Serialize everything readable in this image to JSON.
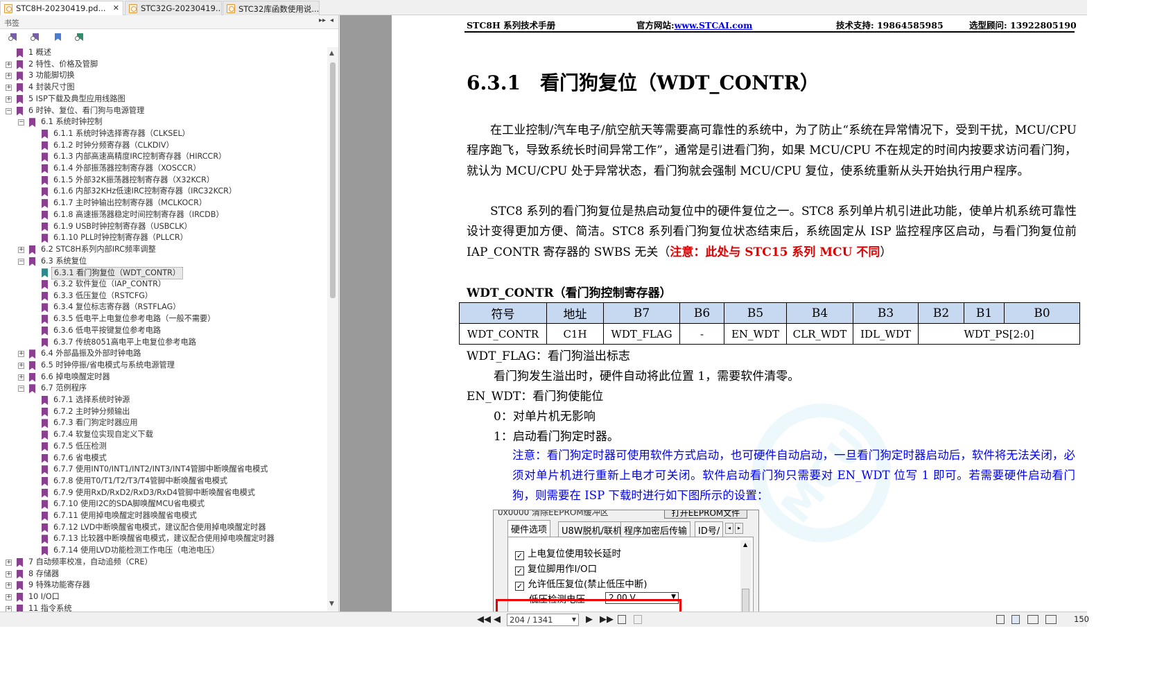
{
  "tabs": [
    {
      "label": "STC8H-20230419.pd...",
      "closable": true,
      "active": true
    },
    {
      "label": "STC32G-20230419....",
      "closable": false,
      "active": false
    },
    {
      "label": "STC32库函数使用说...",
      "closable": false,
      "active": false
    }
  ],
  "sidebar": {
    "title": "书签",
    "collapse_glyph": "▸▸",
    "pin_glyph": "◂",
    "items": [
      {
        "label": "1 概述",
        "level": 0,
        "expand": ""
      },
      {
        "label": "2 特性、价格及管脚",
        "level": 0,
        "expand": "+"
      },
      {
        "label": "3 功能脚切换",
        "level": 0,
        "expand": "+"
      },
      {
        "label": "4 封装尺寸图",
        "level": 0,
        "expand": "+"
      },
      {
        "label": "5 ISP下载及典型应用线路图",
        "level": 0,
        "expand": "+"
      },
      {
        "label": "6 时钟、复位、看门狗与电源管理",
        "level": 0,
        "expand": "−"
      },
      {
        "label": "6.1 系统时钟控制",
        "level": 1,
        "expand": "−"
      },
      {
        "label": "6.1.1 系统时钟选择寄存器（CLKSEL）",
        "level": 2,
        "expand": ""
      },
      {
        "label": "6.1.2 时钟分频寄存器（CLKDIV）",
        "level": 2,
        "expand": ""
      },
      {
        "label": "6.1.3 内部高速高精度IRC控制寄存器（HIRCCR）",
        "level": 2,
        "expand": ""
      },
      {
        "label": "6.1.4 外部振荡器控制寄存器（XOSCCR）",
        "level": 2,
        "expand": ""
      },
      {
        "label": "6.1.5 外部32K振荡器控制寄存器（X32KCR）",
        "level": 2,
        "expand": ""
      },
      {
        "label": "6.1.6 内部32KHz低速IRC控制寄存器（IRC32KCR）",
        "level": 2,
        "expand": ""
      },
      {
        "label": "6.1.7 主时钟输出控制寄存器（MCLKOCR）",
        "level": 2,
        "expand": ""
      },
      {
        "label": "6.1.8 高速振荡器稳定时间控制寄存器（IRCDB）",
        "level": 2,
        "expand": ""
      },
      {
        "label": "6.1.9 USB时钟控制寄存器（USBCLK）",
        "level": 2,
        "expand": ""
      },
      {
        "label": "6.1.10 PLL时钟控制寄存器（PLLCR）",
        "level": 2,
        "expand": ""
      },
      {
        "label": "6.2 STC8H系列内部IRC频率调整",
        "level": 1,
        "expand": "+"
      },
      {
        "label": "6.3 系统复位",
        "level": 1,
        "expand": "−"
      },
      {
        "label": "6.3.1 看门狗复位（WDT_CONTR）",
        "level": 2,
        "expand": "",
        "selected": true
      },
      {
        "label": "6.3.2 软件复位（IAP_CONTR）",
        "level": 2,
        "expand": ""
      },
      {
        "label": "6.3.3 低压复位（RSTCFG）",
        "level": 2,
        "expand": ""
      },
      {
        "label": "6.3.4 复位标志寄存器（RSTFLAG）",
        "level": 2,
        "expand": ""
      },
      {
        "label": "6.3.5 低电平上电复位参考电路（一般不需要）",
        "level": 2,
        "expand": ""
      },
      {
        "label": "6.3.6 低电平按键复位参考电路",
        "level": 2,
        "expand": ""
      },
      {
        "label": "6.3.7 传统8051高电平上电复位参考电路",
        "level": 2,
        "expand": ""
      },
      {
        "label": "6.4 外部晶振及外部时钟电路",
        "level": 1,
        "expand": "+"
      },
      {
        "label": "6.5 时钟停振/省电模式与系统电源管理",
        "level": 1,
        "expand": "+"
      },
      {
        "label": "6.6 掉电唤醒定时器",
        "level": 1,
        "expand": "+"
      },
      {
        "label": "6.7 范例程序",
        "level": 1,
        "expand": "−"
      },
      {
        "label": "6.7.1 选择系统时钟源",
        "level": 2,
        "expand": ""
      },
      {
        "label": "6.7.2 主时钟分频输出",
        "level": 2,
        "expand": ""
      },
      {
        "label": "6.7.3 看门狗定时器应用",
        "level": 2,
        "expand": ""
      },
      {
        "label": "6.7.4 软复位实现自定义下载",
        "level": 2,
        "expand": ""
      },
      {
        "label": "6.7.5 低压检测",
        "level": 2,
        "expand": ""
      },
      {
        "label": "6.7.6 省电模式",
        "level": 2,
        "expand": ""
      },
      {
        "label": "6.7.7 使用INT0/INT1/INT2/INT3/INT4管脚中断唤醒省电模式",
        "level": 2,
        "expand": ""
      },
      {
        "label": "6.7.8 使用T0/T1/T2/T3/T4管脚中断唤醒省电模式",
        "level": 2,
        "expand": ""
      },
      {
        "label": "6.7.9 使用RxD/RxD2/RxD3/RxD4管脚中断唤醒省电模式",
        "level": 2,
        "expand": ""
      },
      {
        "label": "6.7.10 使用I2C的SDA脚唤醒MCU省电模式",
        "level": 2,
        "expand": ""
      },
      {
        "label": "6.7.11 使用掉电唤醒定时器唤醒省电模式",
        "level": 2,
        "expand": ""
      },
      {
        "label": "6.7.12 LVD中断唤醒省电模式，建议配合使用掉电唤醒定时器",
        "level": 2,
        "expand": ""
      },
      {
        "label": "6.7.13 比较器中断唤醒省电模式，建议配合使用掉电唤醒定时器",
        "level": 2,
        "expand": ""
      },
      {
        "label": "6.7.14 使用LVD功能检测工作电压（电池电压）",
        "level": 2,
        "expand": ""
      },
      {
        "label": "7 自动频率校准，自动追频（CRE）",
        "level": 0,
        "expand": "+"
      },
      {
        "label": "8 存储器",
        "level": 0,
        "expand": "+"
      },
      {
        "label": "9 特殊功能寄存器",
        "level": 0,
        "expand": "+"
      },
      {
        "label": "10 I/O口",
        "level": 0,
        "expand": "+"
      },
      {
        "label": "11 指令系统",
        "level": 0,
        "expand": "+"
      }
    ]
  },
  "document": {
    "header": {
      "manual": "STC8H 系列技术手册",
      "site_label": "官方网站:",
      "site_url": "www.STCAI.com",
      "support": "技术支持: 19864585985",
      "sales": "选型顾问: 13922805190"
    },
    "heading": "6.3.1　看门狗复位（WDT_CONTR）",
    "para1": "在工业控制/汽车电子/航空航天等需要高可靠性的系统中，为了防止“系统在异常情况下，受到干扰，MCU/CPU 程序跑飞，导致系统长时间异常工作”，通常是引进看门狗，如果 MCU/CPU 不在规定的时间内按要求访问看门狗，就认为 MCU/CPU 处于异常状态，看门狗就会强制 MCU/CPU 复位，使系统重新从头开始执行用户程序。",
    "para2_pre": "STC8 系列的看门狗复位是热启动复位中的硬件复位之一。STC8 系列单片机引进此功能，使单片机系统可靠性设计变得更加方便、简洁。STC8 系列看门狗复位状态结束后，系统固定从 ISP 监控程序区启动，与看门狗复位前 IAP_CONTR 寄存器的 SWBS 无关（",
    "para2_note": "注意：此处与 STC15 系列 MCU 不同",
    "para2_post": "）",
    "reg_title": "WDT_CONTR（看门狗控制寄存器）",
    "reg_head": [
      "符号",
      "地址",
      "B7",
      "B6",
      "B5",
      "B4",
      "B3",
      "B2",
      "B1",
      "B0"
    ],
    "reg_row": [
      "WDT_CONTR",
      "C1H",
      "WDT_FLAG",
      "-",
      "EN_WDT",
      "CLR_WDT",
      "IDL_WDT",
      "WDT_PS[2:0]"
    ],
    "flag_title": "WDT_FLAG：看门狗溢出标志",
    "flag_desc": "看门狗发生溢出时，硬件自动将此位置 1，需要软件清零。",
    "en_title": "EN_WDT：看门狗使能位",
    "en_0": "0：对单片机无影响",
    "en_1": "1：启动看门狗定时器。",
    "note": "注意：看门狗定时器可使用软件方式启动，也可硬件自动启动，一旦看门狗定时器启动后，软件将无法关闭，必须对单片机进行重新上电才可关闭。软件启动看门狗只需要对 EN_WDT 位写 1 即可。若需要硬件启动看门狗，则需要在 ISP 下载时进行如下图所示的设置：",
    "embedded": {
      "top_text": "0x0000  清除EEPROM缓冲区",
      "top_button": "打开EEPROM文件",
      "tabs": [
        "硬件选项",
        "U8W脱机/联机",
        "程序加密后传输",
        "ID号/"
      ],
      "options": [
        {
          "label": "上电复位使用较长延时",
          "checked": true
        },
        {
          "label": "复位脚用作I/O口",
          "checked": true
        },
        {
          "label": "允许低压复位(禁止低压中断)",
          "checked": true
        }
      ],
      "voltage_label": "低压检测电压",
      "voltage_value": "2.00 V"
    }
  },
  "statusbar": {
    "page": "204 / 1341",
    "zoom": "150"
  }
}
